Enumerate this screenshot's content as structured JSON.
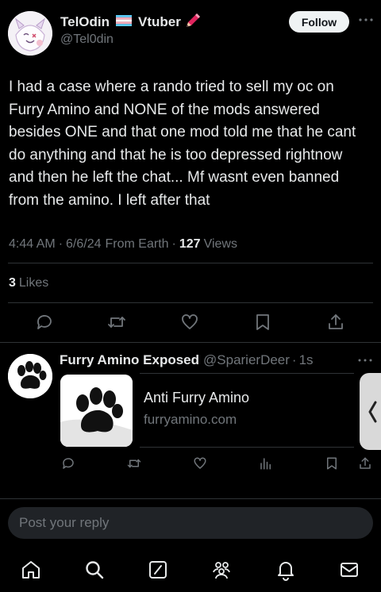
{
  "tweet": {
    "display_name": "TelOdin",
    "name_suffix": "Vtuber",
    "handle": "@Tel0din",
    "follow_label": "Follow",
    "text": "I had a case where a rando tried to sell my oc on Furry Amino and NONE of the mods answered besides ONE and that one mod told me that he cant do anything and that he is too depressed rightnow and then he left the chat... Mf wasnt even banned from the amino. I left after that",
    "time": "4:44 AM",
    "date": "6/6/24",
    "source": "From Earth",
    "views_count": "127",
    "views_label": "Views",
    "likes_count": "3",
    "likes_label": "Likes"
  },
  "reply": {
    "display_name": "Furry Amino Exposed",
    "handle": "@SparierDeer",
    "time": "1s",
    "card_title": "Anti Furry Amino",
    "card_domain": "furryamino.com"
  },
  "composer": {
    "placeholder": "Post your reply"
  },
  "colors": {
    "accent": "#1d9bf0",
    "divider": "#2f3336",
    "muted": "#71767b",
    "flag_blue": "#5bcefa",
    "flag_pink": "#f5a9b8",
    "pen": "#e0245e"
  },
  "icons": {
    "action_bar": [
      "reply-icon",
      "repost-icon",
      "like-icon",
      "bookmark-icon",
      "share-icon"
    ],
    "reply_action_bar": [
      "reply-icon",
      "repost-icon",
      "like-icon",
      "views-icon",
      "bookmark-icon",
      "share-icon"
    ],
    "bottom_nav": [
      "home-icon",
      "search-icon",
      "grok-icon",
      "communities-icon",
      "notifications-icon",
      "messages-icon"
    ]
  }
}
